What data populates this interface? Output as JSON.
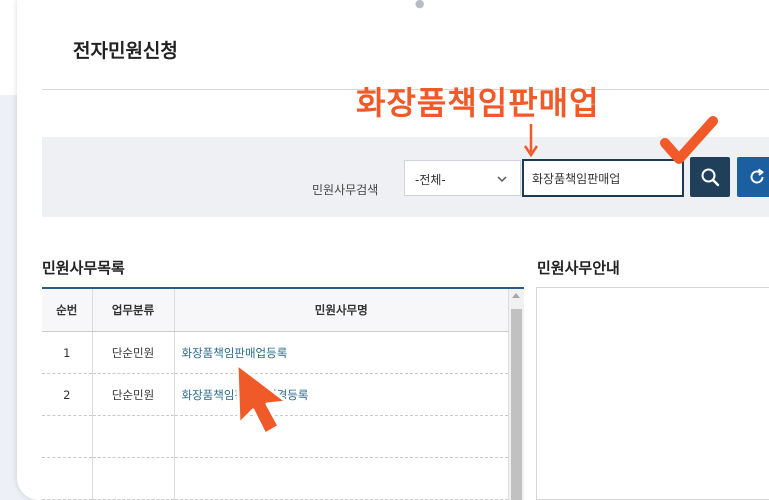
{
  "page": {
    "title": "전자민원신청"
  },
  "annotation": {
    "highlight_text": "화장품책임판매업"
  },
  "search": {
    "label": "민원사무검색",
    "category_selected": "-전체-",
    "query": "화장품책임판매업"
  },
  "list": {
    "title": "민원사무목록",
    "columns": [
      "순번",
      "업무분류",
      "민원사무명"
    ],
    "rows": [
      {
        "no": "1",
        "category": "단순민원",
        "name": "화장품책임판매업등록"
      },
      {
        "no": "2",
        "category": "단순민원",
        "name": "화장품책임판매업변경등록"
      }
    ]
  },
  "info": {
    "title": "민원사무안내"
  },
  "colors": {
    "accent_orange": "#f05a28",
    "nav_dark": "#1f3f5b",
    "nav_blue": "#1c5fa0"
  }
}
